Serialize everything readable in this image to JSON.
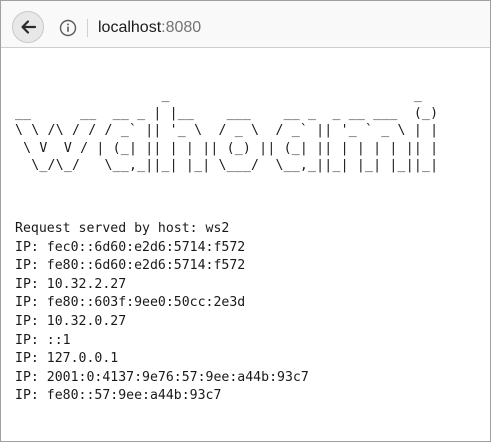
{
  "browser": {
    "url_host": "localhost",
    "url_port": ":8080",
    "back_icon": "arrow-left-icon",
    "info_icon": "info-circle-icon"
  },
  "page": {
    "banner_ascii": "                  _                              _ \n__      __  __ _ | |__    ___    __ _  _ __ ___  (_)\n\\ \\ /\\ / / / _` || '_ \\  / _ \\  / _` || '_ ` _ \\ | |\n \\ V  V / | (_| || | | || (_) || (_| || | | | | || |\n  \\_/\\_/   \\__,_||_| |_| \\___/  \\__,_||_| |_| |_||_|",
    "lines": [
      "Request served by host: ws2",
      "IP: fec0::6d60:e2d6:5714:f572",
      "IP: fe80::6d60:e2d6:5714:f572",
      "IP: 10.32.2.27",
      "IP: fe80::603f:9ee0:50cc:2e3d",
      "IP: 10.32.0.27",
      "IP: ::1",
      "IP: 127.0.0.1",
      "IP: 2001:0:4137:9e76:57:9ee:a44b:93c7",
      "IP: fe80::57:9ee:a44b:93c7"
    ]
  }
}
